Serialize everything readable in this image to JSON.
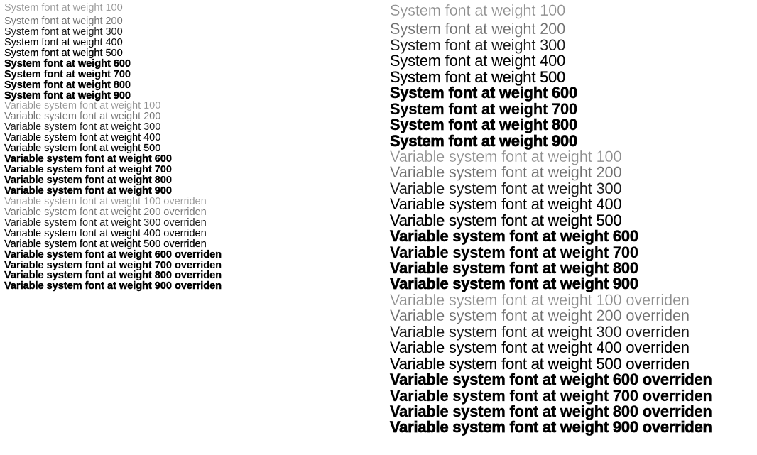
{
  "page": {
    "title": "Font weight specimen",
    "background_color": "#ffffff",
    "text_color": "#000000"
  },
  "columns": [
    {
      "name": "small-size-column",
      "font_size_px": 14.6,
      "lines": [
        {
          "text": "System font at weight 100",
          "weight": 100
        },
        {
          "text": "System font at weight 200",
          "weight": 200
        },
        {
          "text": "System font at weight 300",
          "weight": 300
        },
        {
          "text": "System font at weight 400",
          "weight": 400
        },
        {
          "text": "System font at weight 500",
          "weight": 500
        },
        {
          "text": "System font at weight 600",
          "weight": 600
        },
        {
          "text": "System font at weight 700",
          "weight": 700
        },
        {
          "text": "System font at weight 800",
          "weight": 800
        },
        {
          "text": "System font at weight 900",
          "weight": 900
        },
        {
          "text": "Variable system font at weight 100",
          "weight": 100
        },
        {
          "text": "Variable system font at weight 200",
          "weight": 200
        },
        {
          "text": "Variable system font at weight 300",
          "weight": 300
        },
        {
          "text": "Variable system font at weight 400",
          "weight": 400
        },
        {
          "text": "Variable system font at weight 500",
          "weight": 500
        },
        {
          "text": "Variable system font at weight 600",
          "weight": 600
        },
        {
          "text": "Variable system font at weight 700",
          "weight": 700
        },
        {
          "text": "Variable system font at weight 800",
          "weight": 800
        },
        {
          "text": "Variable system font at weight 900",
          "weight": 900
        },
        {
          "text": "Variable system font at weight 100 overriden",
          "weight": 100
        },
        {
          "text": "Variable system font at weight 200 overriden",
          "weight": 200
        },
        {
          "text": "Variable system font at weight 300 overriden",
          "weight": 300
        },
        {
          "text": "Variable system font at weight 400 overriden",
          "weight": 400
        },
        {
          "text": "Variable system font at weight 500 overriden",
          "weight": 500
        },
        {
          "text": "Variable system font at weight 600 overriden",
          "weight": 600
        },
        {
          "text": "Variable system font at weight 700 overriden",
          "weight": 700
        },
        {
          "text": "Variable system font at weight 800 overriden",
          "weight": 800
        },
        {
          "text": "Variable system font at weight 900 overriden",
          "weight": 900
        }
      ]
    },
    {
      "name": "large-size-column",
      "font_size_px": 21.8,
      "lines": [
        {
          "text": "System font at weight 100",
          "weight": 100
        },
        {
          "text": "System font at weight 200",
          "weight": 200
        },
        {
          "text": "System font at weight 300",
          "weight": 300
        },
        {
          "text": "System font at weight 400",
          "weight": 400
        },
        {
          "text": "System font at weight 500",
          "weight": 500
        },
        {
          "text": "System font at weight 600",
          "weight": 600
        },
        {
          "text": "System font at weight 700",
          "weight": 700
        },
        {
          "text": "System font at weight 800",
          "weight": 800
        },
        {
          "text": "System font at weight 900",
          "weight": 900
        },
        {
          "text": "Variable system font at weight 100",
          "weight": 100
        },
        {
          "text": "Variable system font at weight 200",
          "weight": 200
        },
        {
          "text": "Variable system font at weight 300",
          "weight": 300
        },
        {
          "text": "Variable system font at weight 400",
          "weight": 400
        },
        {
          "text": "Variable system font at weight 500",
          "weight": 500
        },
        {
          "text": "Variable system font at weight 600",
          "weight": 600
        },
        {
          "text": "Variable system font at weight 700",
          "weight": 700
        },
        {
          "text": "Variable system font at weight 800",
          "weight": 800
        },
        {
          "text": "Variable system font at weight 900",
          "weight": 900
        },
        {
          "text": "Variable system font at weight 100 overriden",
          "weight": 100
        },
        {
          "text": "Variable system font at weight 200 overriden",
          "weight": 200
        },
        {
          "text": "Variable system font at weight 300 overriden",
          "weight": 300
        },
        {
          "text": "Variable system font at weight 400 overriden",
          "weight": 400
        },
        {
          "text": "Variable system font at weight 500 overriden",
          "weight": 500
        },
        {
          "text": "Variable system font at weight 600 overriden",
          "weight": 600
        },
        {
          "text": "Variable system font at weight 700 overriden",
          "weight": 700
        },
        {
          "text": "Variable system font at weight 800 overriden",
          "weight": 800
        },
        {
          "text": "Variable system font at weight 900 overriden",
          "weight": 900
        }
      ]
    }
  ]
}
